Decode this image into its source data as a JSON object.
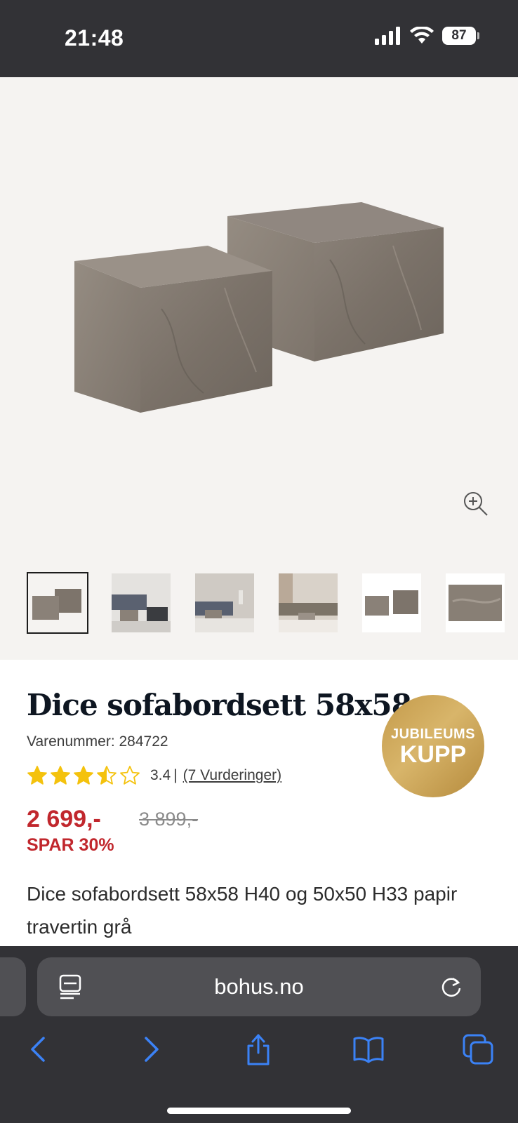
{
  "status_bar": {
    "time": "21:48",
    "battery": "87",
    "icons": [
      "cellular-signal-icon",
      "wifi-icon",
      "battery-icon"
    ]
  },
  "gallery": {
    "main_image": "dice-coffee-table-set-photo",
    "zoom_icon": "zoom-in-icon",
    "thumbnails": [
      {
        "name": "thumb-product",
        "active": true
      },
      {
        "name": "thumb-living-room-1",
        "active": false
      },
      {
        "name": "thumb-living-room-2",
        "active": false
      },
      {
        "name": "thumb-living-room-3",
        "active": false
      },
      {
        "name": "thumb-product-white",
        "active": false
      },
      {
        "name": "thumb-texture-closeup",
        "active": false
      }
    ]
  },
  "product": {
    "title": "Dice sofabordsett 58x58",
    "sku": "Varenummer: 284722",
    "rating_value": 3.4,
    "rating_text": "3.4",
    "rating_separator": "|",
    "reviews_link": "(7 Vurderinger)",
    "price": "2 699,-",
    "old_price": "3 899,-",
    "save": "SPAR 30%",
    "badge_top": "JUBILEUMS",
    "badge_bottom": "KUPP",
    "description": "Dice sofabordsett 58x58 H40 og 50x50 H33 papir travertin grå"
  },
  "browser": {
    "url": "bohus.no",
    "icons": [
      "reader-icon",
      "reload-icon",
      "back-icon",
      "forward-icon",
      "share-icon",
      "bookmarks-icon",
      "tabs-icon"
    ]
  },
  "colors": {
    "price_red": "#c1272d",
    "star_yellow": "#f4c20d",
    "ios_blue": "#3b82f6",
    "badge_gold": "#c49a4a"
  }
}
